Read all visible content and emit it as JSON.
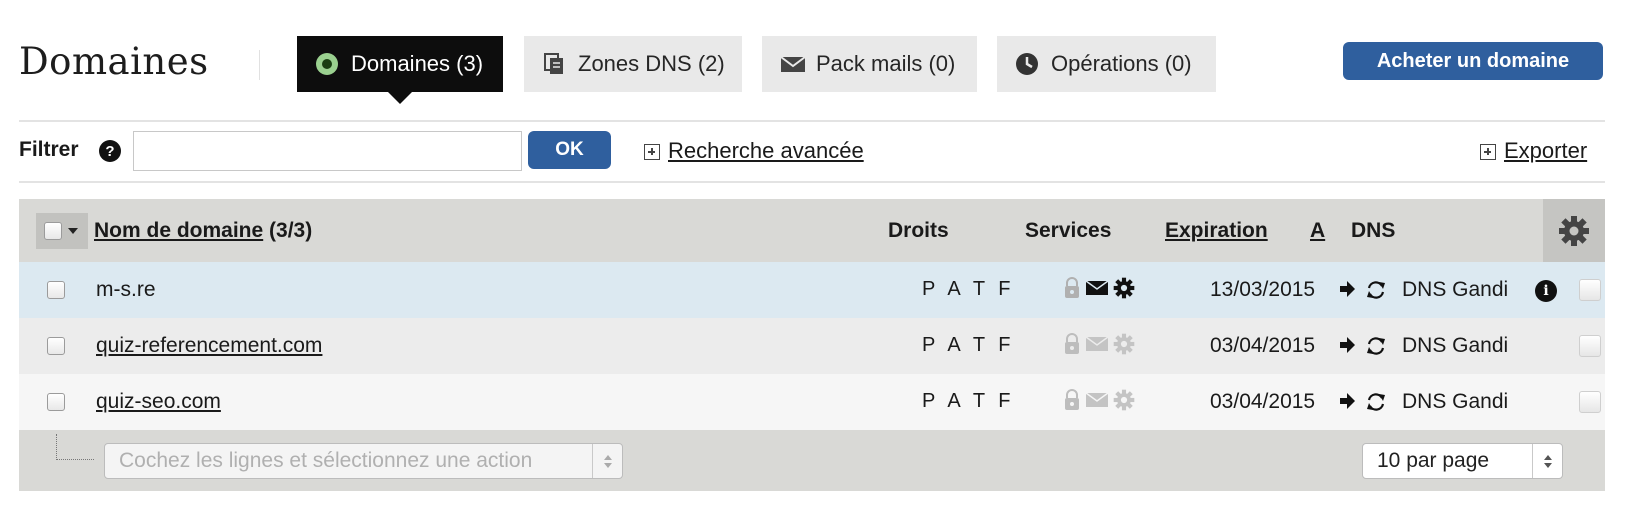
{
  "header": {
    "title": "Domaines",
    "buy_button": "Acheter un domaine",
    "tabs": [
      {
        "label": "Domaines (3)",
        "icon": "record-icon",
        "active": true
      },
      {
        "label": "Zones DNS (2)",
        "icon": "documents-icon",
        "active": false
      },
      {
        "label": "Pack mails (0)",
        "icon": "envelope-icon",
        "active": false
      },
      {
        "label": "Opérations (0)",
        "icon": "clock-icon",
        "active": false
      }
    ]
  },
  "filter": {
    "label": "Filtrer",
    "input_value": "",
    "ok_label": "OK",
    "advanced_search": "Recherche avancée",
    "export": "Exporter"
  },
  "table": {
    "columns": {
      "name": "Nom de domaine",
      "name_count": "(3/3)",
      "rights": "Droits",
      "services": "Services",
      "expiration": "Expiration",
      "auto": "A",
      "dns": "DNS"
    },
    "rows": [
      {
        "name": "m-s.re",
        "rights": "P A T F",
        "services_active": true,
        "expiration": "13/03/2015",
        "dns": "DNS Gandi",
        "has_info": true
      },
      {
        "name": "quiz-referencement.com",
        "rights": "P A T F",
        "services_active": false,
        "expiration": "03/04/2015",
        "dns": "DNS Gandi",
        "has_info": false
      },
      {
        "name": "quiz-seo.com",
        "rights": "P A T F",
        "services_active": false,
        "expiration": "03/04/2015",
        "dns": "DNS Gandi",
        "has_info": false
      }
    ],
    "footer": {
      "action_placeholder": "Cochez les lignes et sélectionnez une action",
      "per_page": "10 par page"
    }
  },
  "colors": {
    "accent_blue": "#2f5f9e",
    "active_tab": "#0d0d0d",
    "selected_row": "#dce9f1",
    "header_gray": "#d9d9d6"
  }
}
